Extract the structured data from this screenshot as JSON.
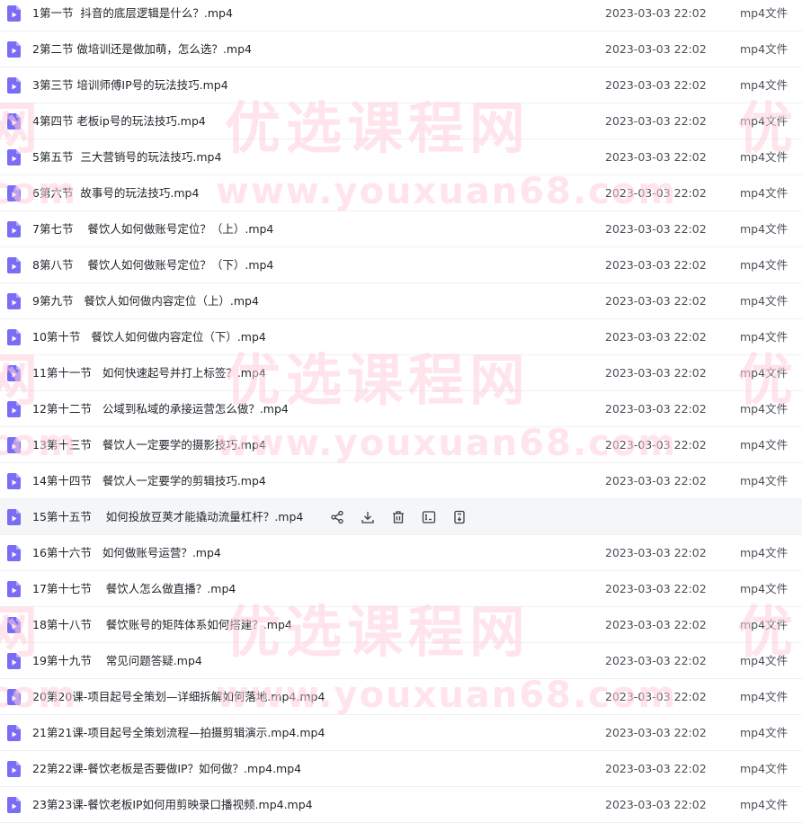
{
  "files": [
    {
      "name": "1第一节  抖音的底层逻辑是什么？.mp4",
      "date": "2023-03-03 22:02",
      "type": "mp4文件"
    },
    {
      "name": "2第二节 做培训还是做加萌，怎么选？.mp4",
      "date": "2023-03-03 22:02",
      "type": "mp4文件"
    },
    {
      "name": "3第三节 培训师傅IP号的玩法技巧.mp4",
      "date": "2023-03-03 22:02",
      "type": "mp4文件"
    },
    {
      "name": "4第四节 老板ip号的玩法技巧.mp4",
      "date": "2023-03-03 22:02",
      "type": "mp4文件"
    },
    {
      "name": "5第五节  三大营销号的玩法技巧.mp4",
      "date": "2023-03-03 22:02",
      "type": "mp4文件"
    },
    {
      "name": "6第六节  故事号的玩法技巧.mp4",
      "date": "2023-03-03 22:02",
      "type": "mp4文件"
    },
    {
      "name": "7第七节    餐饮人如何做账号定位？（上）.mp4",
      "date": "2023-03-03 22:02",
      "type": "mp4文件"
    },
    {
      "name": "8第八节    餐饮人如何做账号定位？（下）.mp4",
      "date": "2023-03-03 22:02",
      "type": "mp4文件"
    },
    {
      "name": "9第九节   餐饮人如何做内容定位（上）.mp4",
      "date": "2023-03-03 22:02",
      "type": "mp4文件"
    },
    {
      "name": "10第十节   餐饮人如何做内容定位（下）.mp4",
      "date": "2023-03-03 22:02",
      "type": "mp4文件"
    },
    {
      "name": "11第十一节   如何快速起号并打上标签？.mp4",
      "date": "2023-03-03 22:02",
      "type": "mp4文件"
    },
    {
      "name": "12第十二节   公域到私域的承接运营怎么做？.mp4",
      "date": "2023-03-03 22:02",
      "type": "mp4文件"
    },
    {
      "name": "13第十三节   餐饮人一定要学的摄影技巧.mp4",
      "date": "2023-03-03 22:02",
      "type": "mp4文件"
    },
    {
      "name": "14第十四节   餐饮人一定要学的剪辑技巧.mp4",
      "date": "2023-03-03 22:02",
      "type": "mp4文件"
    },
    {
      "name": "15第十五节    如何投放豆荚才能撬动流量杠杆？.mp4",
      "date": "",
      "type": "",
      "hovered": true
    },
    {
      "name": "16第十六节   如何做账号运营？.mp4",
      "date": "2023-03-03 22:02",
      "type": "mp4文件"
    },
    {
      "name": "17第十七节    餐饮人怎么做直播？.mp4",
      "date": "2023-03-03 22:02",
      "type": "mp4文件"
    },
    {
      "name": "18第十八节    餐饮账号的矩阵体系如何搭建？.mp4",
      "date": "2023-03-03 22:02",
      "type": "mp4文件"
    },
    {
      "name": "19第十九节    常见问题答疑.mp4",
      "date": "2023-03-03 22:02",
      "type": "mp4文件"
    },
    {
      "name": "20第20课-项目起号全策划—详细拆解如何落地.mp4.mp4",
      "date": "2023-03-03 22:02",
      "type": "mp4文件"
    },
    {
      "name": "21第21课-项目起号全策划流程—拍摄剪辑演示.mp4.mp4",
      "date": "2023-03-03 22:02",
      "type": "mp4文件"
    },
    {
      "name": "22第22课-餐饮老板是否要做IP？如何做？.mp4.mp4",
      "date": "2023-03-03 22:02",
      "type": "mp4文件"
    },
    {
      "name": "23第23课-餐饮老板IP如何用剪映录口播视频.mp4.mp4",
      "date": "2023-03-03 22:02",
      "type": "mp4文件"
    }
  ],
  "row_actions": [
    "share-icon",
    "download-icon",
    "delete-icon",
    "rename-icon",
    "more-icon"
  ],
  "colors": {
    "file_icon": "#7b6cf6",
    "hover_row": "#f5f6f8",
    "watermark": "#ffcddc"
  },
  "watermark": {
    "cn": "优选课程网",
    "url": "www.youxuan68.com",
    "cn_edge_right": "优",
    "cn_edge_left": "网",
    "url_edge_left": ".com"
  }
}
